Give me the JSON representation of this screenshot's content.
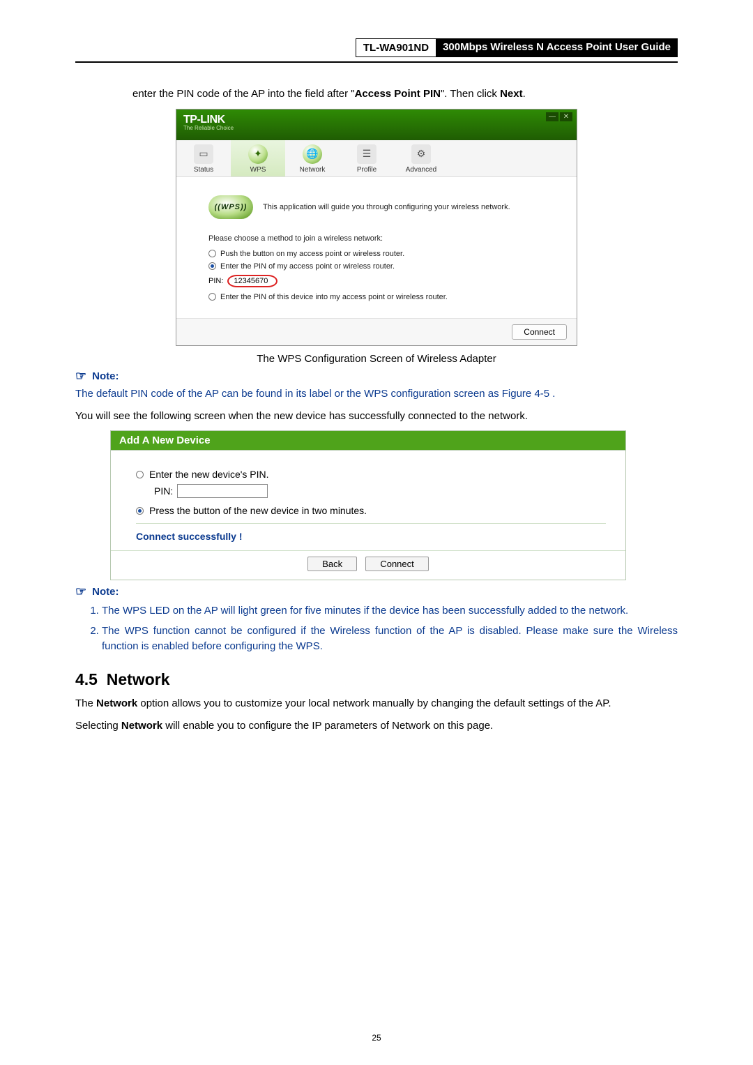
{
  "header": {
    "model": "TL-WA901ND",
    "title": "300Mbps Wireless N Access Point User Guide"
  },
  "intro": {
    "line1_a": "enter the PIN code of the AP into the field after \"",
    "line1_b": "Access Point PIN",
    "line1_c": "\". Then click ",
    "line1_d": "Next",
    "line1_e": "."
  },
  "app1": {
    "logo": "TP-LINK",
    "sublogo": "The Reliable Choice",
    "win": {
      "min": "—",
      "close": "✕"
    },
    "tabs": {
      "status": "Status",
      "wps": "WPS",
      "network": "Network",
      "profile": "Profile",
      "advanced": "Advanced"
    },
    "wps_badge": "((WPS))",
    "wps_desc": "This application will guide you through configuring your wireless network.",
    "choose": "Please choose a method to join a wireless network:",
    "opt1": "Push the button on my access point or wireless router.",
    "opt2": "Enter the PIN of my access point or wireless router.",
    "pin_label": "PIN:",
    "pin_value": "12345670",
    "opt3": "Enter the PIN of this device into my access point or wireless router.",
    "connect": "Connect"
  },
  "caption1": "The WPS Configuration Screen of Wireless Adapter",
  "note_label": "Note:",
  "note1_body": "The default PIN code of the AP can be found in its label or the WPS configuration screen as Figure 4-5 .",
  "after_note1": "You will see the following screen when the new device has successfully connected to the network.",
  "app2": {
    "title": "Add A New Device",
    "opt1": "Enter the new device's PIN.",
    "pin_label": "PIN:",
    "opt2": "Press the button of the new device in two minutes.",
    "status": "Connect successfully !",
    "back": "Back",
    "connect": "Connect"
  },
  "note2_items": [
    "The WPS LED on the AP will light green for five minutes if the device has been successfully added to the network.",
    "The WPS function cannot be configured if the Wireless function of the AP is disabled. Please make sure the Wireless function is enabled before configuring the WPS."
  ],
  "section": {
    "num": "4.5",
    "title": "Network"
  },
  "section_body": {
    "p1a": "The ",
    "p1b": "Network",
    "p1c": " option allows you to customize your local network manually by changing the default settings of the AP.",
    "p2a": "Selecting ",
    "p2b": "Network",
    "p2c": " will enable you to configure the IP parameters of Network on this page."
  },
  "page_number": "25"
}
